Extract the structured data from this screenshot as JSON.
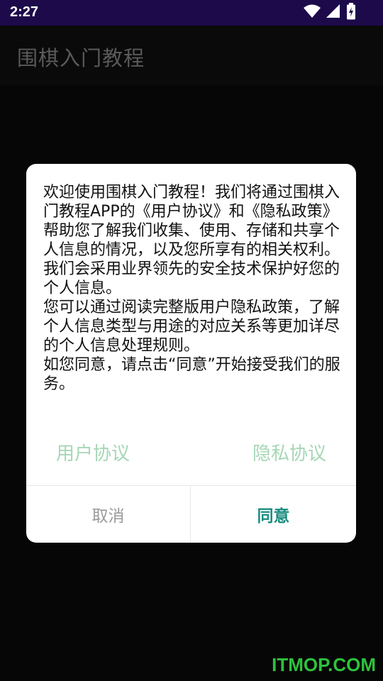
{
  "status_bar": {
    "time": "2:27",
    "icons": [
      "wifi-icon",
      "signal-icon",
      "battery-charging-icon"
    ]
  },
  "app_bar": {
    "title": "围棋入门教程"
  },
  "dialog": {
    "paragraphs": [
      "欢迎使用围棋入门教程！我们将通过围棋入门教程APP的《用户协议》和《隐私政策》帮助您了解我们收集、使用、存储和共享个人信息的情况，以及您所享有的相关权利。",
      "我们会采用业界领先的安全技术保护好您的个人信息。",
      "您可以通过阅读完整版用户隐私政策，了解个人信息类型与用途的对应关系等更加详尽的个人信息处理规则。",
      "如您同意，请点击“同意”开始接受我们的服务。"
    ],
    "links": {
      "user_agreement": "用户协议",
      "privacy_agreement": "隐私协议"
    },
    "buttons": {
      "cancel": "取消",
      "agree": "同意"
    }
  },
  "watermark": "ITMOP.COM",
  "colors": {
    "status_bar_bg": "#1c0a4a",
    "link_color": "#a6d7b5",
    "agree_color": "#1a8c80",
    "watermark_color": "#2ec23c"
  }
}
